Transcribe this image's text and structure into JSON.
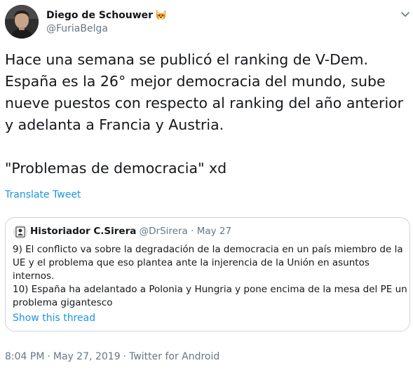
{
  "author": {
    "display_name": "Diego de Schouwer",
    "name_emoji_icon": "fox-face-icon",
    "handle": "@FuriaBelga"
  },
  "tweet": {
    "lines": [
      "Hace una semana se publicó el ranking de V-Dem.",
      "España es la 26° mejor democracia del mundo, sube",
      "nueve puestos con respecto al ranking del año anterior",
      "y adelanta a Francia y Austria.",
      "\"Problemas de democracia\" xd"
    ],
    "translate_label": "Translate Tweet"
  },
  "quoted_tweet": {
    "display_name": "Historiador C.Sirera",
    "handle": "@DrSirera",
    "separator": "·",
    "date": "May 27",
    "lines": [
      "9) El conflicto va sobre la degradación de la democracia en un país miembro de la",
      "UE y el problema que eso plantea ante la injerencia de la Unión en asuntos",
      "internos.",
      "10) España ha adelantado a Polonia y Hungria y pone encima de la mesa del PE un",
      "problema gigantesco"
    ],
    "show_thread_label": "Show this thread"
  },
  "footer": {
    "time": "8:04 PM",
    "separator": "·",
    "date": "May 27, 2019",
    "source": "Twitter for Android"
  },
  "icons": {
    "caret": "chevron-down-icon"
  },
  "colors": {
    "text": "#14171a",
    "secondary": "#657786",
    "link": "#1b95e0",
    "border": "#ccd6dd"
  }
}
